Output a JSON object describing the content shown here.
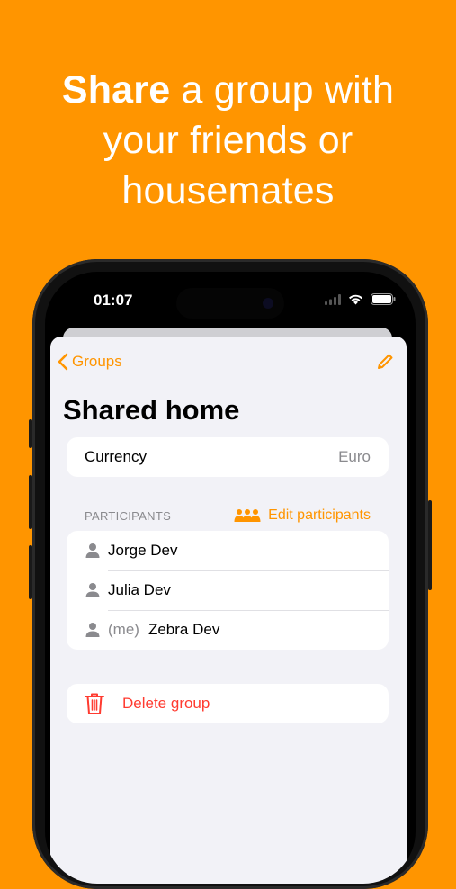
{
  "headline": {
    "bold": "Share",
    "line1_rest": " a group with",
    "line2": "your friends or",
    "line3": "housemates"
  },
  "status_bar": {
    "time": "01:07"
  },
  "nav": {
    "back_label": "Groups"
  },
  "group": {
    "title": "Shared home",
    "currency_label": "Currency",
    "currency_value": "Euro"
  },
  "participants": {
    "header": "PARTICIPANTS",
    "edit_label": "Edit participants",
    "items": [
      {
        "name": "Jorge Dev",
        "tag": ""
      },
      {
        "name": "Julia Dev",
        "tag": ""
      },
      {
        "name": "Zebra Dev",
        "tag": "(me)"
      }
    ]
  },
  "actions": {
    "delete_label": "Delete group"
  },
  "colors": {
    "accent": "#FF9500",
    "destructive": "#FF3B30",
    "background": "#F2F2F7"
  }
}
